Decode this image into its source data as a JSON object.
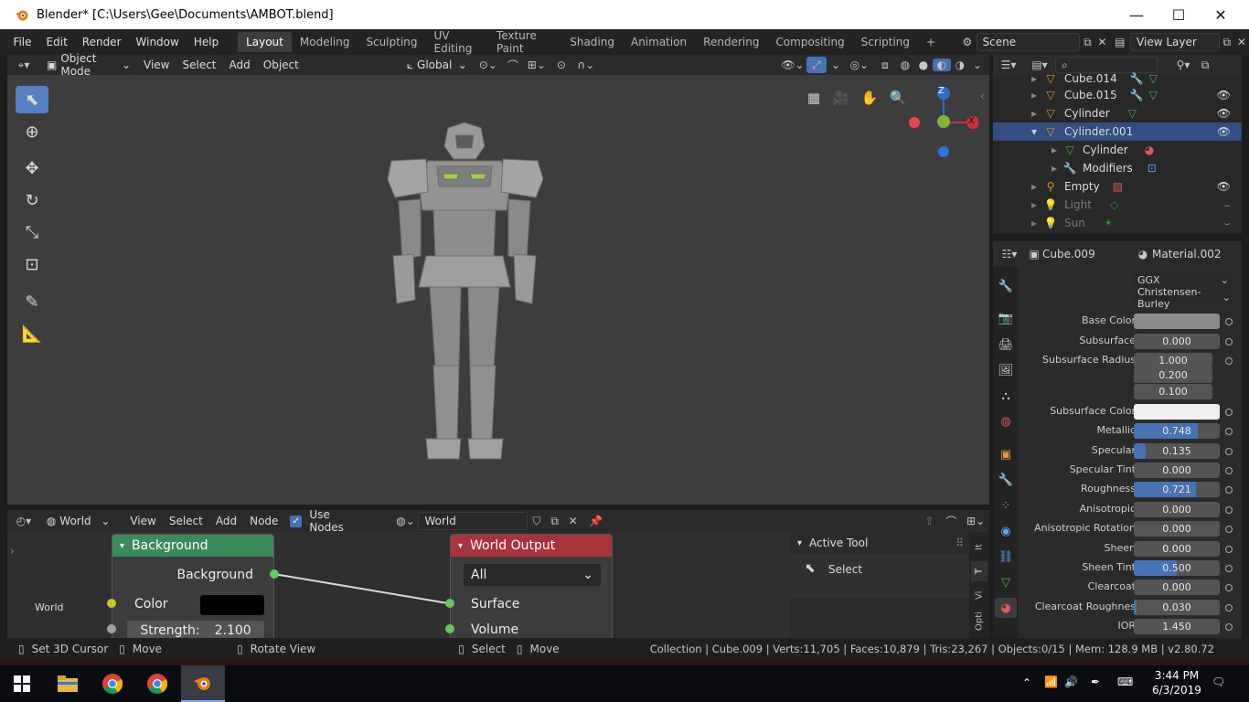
{
  "window": {
    "title": "Blender* [C:\\Users\\Gee\\Documents\\AMBOT.blend]",
    "minimize": "—",
    "maximize": "☐",
    "close": "✕"
  },
  "menu": {
    "items": [
      "File",
      "Edit",
      "Render",
      "Window",
      "Help"
    ],
    "workspaces": [
      "Layout",
      "Modeling",
      "Sculpting",
      "UV Editing",
      "Texture Paint",
      "Shading",
      "Animation",
      "Rendering",
      "Compositing",
      "Scripting"
    ],
    "add_tab": "+",
    "scene": "Scene",
    "view_layer": "View Layer"
  },
  "viewport_header": {
    "mode": "Object Mode",
    "menus": [
      "View",
      "Select",
      "Add",
      "Object"
    ],
    "orientation": "Global"
  },
  "gizmo": {
    "z": "Z",
    "x": "X"
  },
  "outliner": {
    "rows": [
      {
        "label": "Cube.014"
      },
      {
        "label": "Cube.015"
      },
      {
        "label": "Cylinder"
      },
      {
        "label": "Cylinder.001"
      },
      {
        "label": "Cylinder"
      },
      {
        "label": "Modifiers"
      },
      {
        "label": "Empty"
      },
      {
        "label": "Light"
      },
      {
        "label": "Sun"
      }
    ]
  },
  "properties": {
    "object": "Cube.009",
    "material": "Material.002",
    "distribution": "GGX",
    "subsurface_method": "Christensen-Burley",
    "fields": [
      {
        "label": "Base Color",
        "value": "",
        "fraction": 0,
        "swatch": "#8a8a8a"
      },
      {
        "label": "Subsurface",
        "value": "0.000",
        "fraction": 0
      },
      {
        "label": "Subsurface Radius",
        "value": "1.000",
        "fraction": 0
      },
      {
        "label": "",
        "value": "0.200",
        "fraction": 0
      },
      {
        "label": "",
        "value": "0.100",
        "fraction": 0
      },
      {
        "label": "Subsurface Color",
        "value": "",
        "fraction": 0,
        "swatch": "#f0f0f0"
      },
      {
        "label": "Metallic",
        "value": "0.748",
        "fraction": 0.748
      },
      {
        "label": "Specular",
        "value": "0.135",
        "fraction": 0.135
      },
      {
        "label": "Specular Tint",
        "value": "0.000",
        "fraction": 0
      },
      {
        "label": "Roughness",
        "value": "0.721",
        "fraction": 0.721
      },
      {
        "label": "Anisotropic",
        "value": "0.000",
        "fraction": 0
      },
      {
        "label": "Anisotropic Rotation",
        "value": "0.000",
        "fraction": 0
      },
      {
        "label": "Sheen",
        "value": "0.000",
        "fraction": 0
      },
      {
        "label": "Sheen Tint",
        "value": "0.500",
        "fraction": 0.5
      },
      {
        "label": "Clearcoat",
        "value": "0.000",
        "fraction": 0
      },
      {
        "label": "Clearcoat Roughnes",
        "value": "0.030",
        "fraction": 0.03
      },
      {
        "label": "IOR",
        "value": "1.450",
        "fraction": 0
      }
    ]
  },
  "node_editor": {
    "type": "World",
    "menus": [
      "View",
      "Select",
      "Add",
      "Node"
    ],
    "use_nodes": "Use Nodes",
    "world_name": "World",
    "left_label": "World",
    "background_node": {
      "title": "Background",
      "output": "Background",
      "color_label": "Color",
      "strength_label": "Strength:",
      "strength_value": "2.100"
    },
    "world_output_node": {
      "title": "World Output",
      "target": "All",
      "surface": "Surface",
      "volume": "Volume"
    },
    "panel": {
      "title": "Active Tool",
      "tool": "Select"
    },
    "side_tabs": [
      "It",
      "T",
      "Vi",
      "Opti"
    ]
  },
  "statusbar": {
    "left": [
      "Set 3D Cursor",
      "Move",
      "Rotate View",
      "Select",
      "Move"
    ],
    "stats": "Collection | Cube.009 | Verts:11,705 | Faces:10,879 | Tris:23,267 | Objects:0/15 | Mem: 128.9 MB | v2.80.72"
  },
  "taskbar": {
    "time": "3:44 PM",
    "date": "6/3/2019"
  },
  "colors": {
    "accent": "#4772b3",
    "selected_row": "#334d80",
    "background_node_header": "#3b8a5a",
    "output_node_header": "#a8333a"
  }
}
